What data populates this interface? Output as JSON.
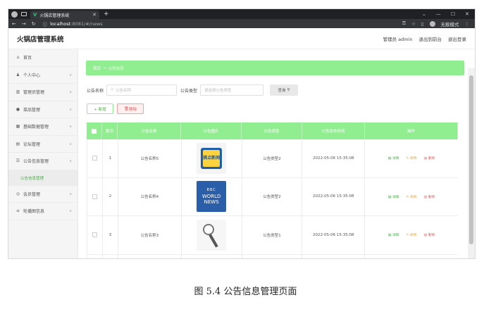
{
  "browser": {
    "tab_title": "火锅店管理系统",
    "url_host": "localhost",
    "url_path": ":8081/#/news",
    "profile_label": "无痕模式"
  },
  "header": {
    "app_title": "火锅店管理系统",
    "user_label": "管理员 admin",
    "back_link": "退出到前台",
    "logout_link": "退出登录"
  },
  "sidebar": {
    "items": [
      {
        "label": "首页",
        "icon": "home-icon"
      },
      {
        "label": "个人中心",
        "icon": "user-icon"
      },
      {
        "label": "管理员管理",
        "icon": "chart-icon"
      },
      {
        "label": "菜品管理",
        "icon": "location-icon"
      },
      {
        "label": "基础数据管理",
        "icon": "grid-icon"
      },
      {
        "label": "论坛管理",
        "icon": "chat-icon"
      },
      {
        "label": "公告信息管理",
        "icon": "settings-icon"
      },
      {
        "label": "会员管理",
        "icon": "member-icon"
      },
      {
        "label": "轮播图信息",
        "icon": "list-icon"
      }
    ],
    "active_sub": "公告信息管理"
  },
  "breadcrumb": {
    "home": "首页",
    "current": "公告信息"
  },
  "search": {
    "name_label": "公告名称",
    "name_placeholder": "公告名称",
    "type_label": "公告类型",
    "type_placeholder": "请选择公告类型",
    "query_button": "查询"
  },
  "actions": {
    "add": "+ 新增",
    "delete": "删除"
  },
  "table": {
    "headers": [
      "索引",
      "公告名称",
      "公告图片",
      "公告类型",
      "公告发布时间",
      "操作"
    ],
    "rows": [
      {
        "index": "1",
        "name": "公告名称5",
        "type": "公告类型2",
        "time": "2022-05-06 15:35:08",
        "image_text": "拂点新闻"
      },
      {
        "index": "2",
        "name": "公告名称4",
        "type": "公告类型2",
        "time": "2022-05-06 15:35:08",
        "image_text_1": "BBC",
        "image_text_2": "WORLD NEWS"
      },
      {
        "index": "3",
        "name": "公告名称3",
        "type": "公告类型1",
        "time": "2022-05-06 15:35:08"
      }
    ],
    "op_detail": "详情",
    "op_edit": "修改",
    "op_delete": "删除"
  },
  "caption": "图 5.4 公告信息管理页面"
}
